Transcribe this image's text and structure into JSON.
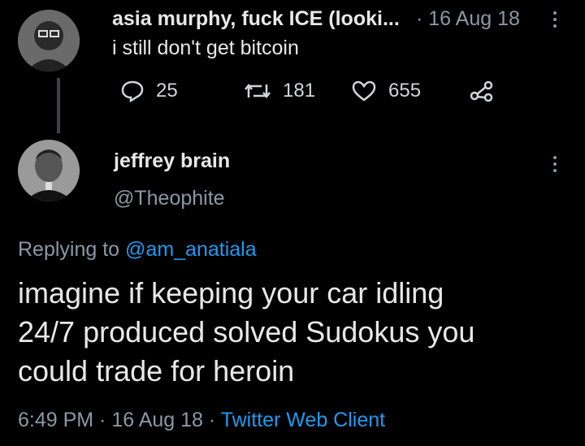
{
  "parent_tweet": {
    "display_name": "asia murphy, fuck ICE (looki...",
    "time": "· 16 Aug 18",
    "text": "i still don't get bitcoin",
    "replies": "25",
    "retweets": "181",
    "likes": "655"
  },
  "reply_tweet": {
    "display_name": "jeffrey brain",
    "handle": "@Theophite",
    "replying_prefix": "Replying to",
    "replying_to": "@am_anatiala",
    "text_line1": "imagine if keeping your car idling",
    "text_line2": "24/7 produced solved Sudokus you",
    "text_line3": "could trade for heroin",
    "timestamp": "6:49 PM · 16 Aug 18 ·",
    "client": "Twitter Web Client"
  },
  "colors": {
    "background": "#000000",
    "secondary_text": "#8b98a5",
    "link": "#1d9bf0"
  },
  "icons": [
    "reply-icon",
    "retweet-icon",
    "like-icon",
    "share-icon",
    "more-icon"
  ]
}
